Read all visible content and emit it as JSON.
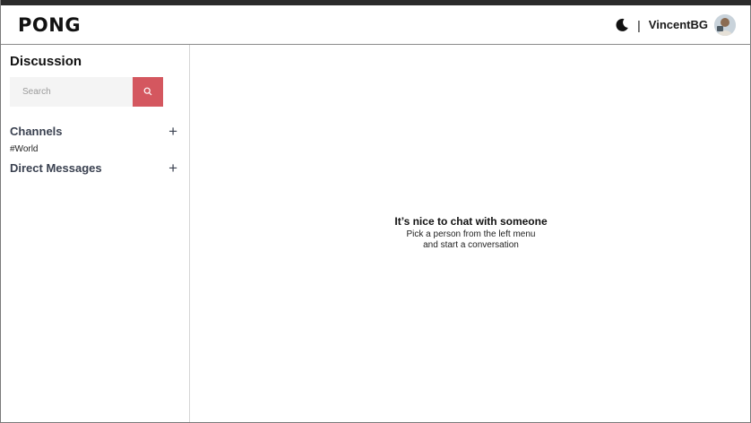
{
  "header": {
    "brand": "PONG",
    "separator": "|",
    "username": "VincentBG",
    "theme_icon": "moon-icon",
    "avatar_icon": "avatar-photo"
  },
  "sidebar": {
    "title": "Discussion",
    "search": {
      "placeholder": "Search",
      "value": "",
      "button_icon": "search-icon"
    },
    "channels": {
      "label": "Channels",
      "add_icon": "plus-icon",
      "items": [
        {
          "label": "#World"
        }
      ]
    },
    "direct_messages": {
      "label": "Direct Messages",
      "add_icon": "plus-icon",
      "items": []
    }
  },
  "main": {
    "empty_title": "It’s nice to chat with someone",
    "empty_line1": "Pick a person from the left menu",
    "empty_line2": "and start a conversation"
  },
  "colors": {
    "accent": "#d4575f",
    "section_text": "#3a4150",
    "top_strip": "#2b2b2b"
  }
}
